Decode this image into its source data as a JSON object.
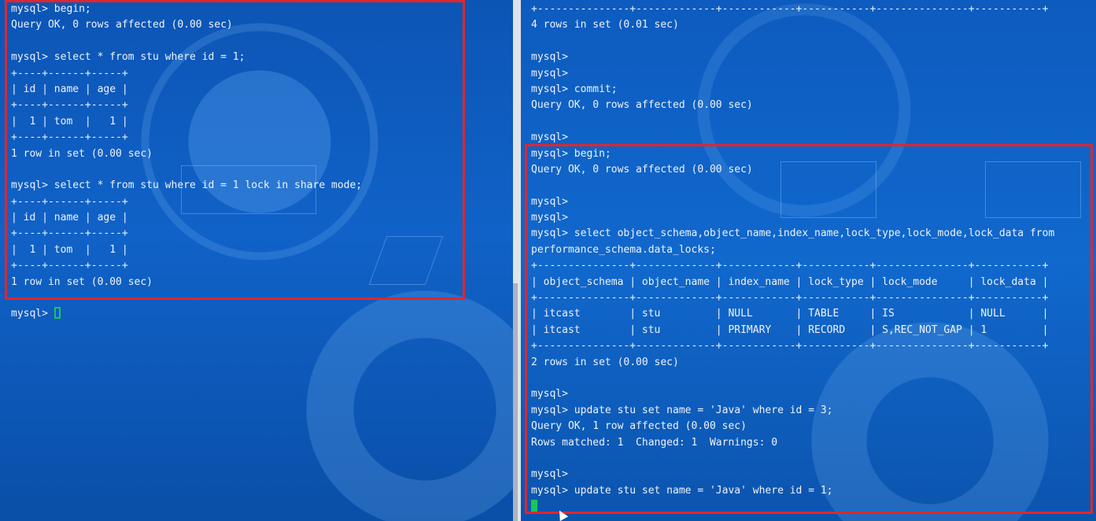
{
  "left_terminal": {
    "lines": [
      "mysql> begin;",
      "Query OK, 0 rows affected (0.00 sec)",
      "",
      "mysql> select * from stu where id = 1;",
      "+----+------+-----+",
      "| id | name | age |",
      "+----+------+-----+",
      "|  1 | tom  |   1 |",
      "+----+------+-----+",
      "1 row in set (0.00 sec)",
      "",
      "mysql> select * from stu where id = 1 lock in share mode;",
      "+----+------+-----+",
      "| id | name | age |",
      "+----+------+-----+",
      "|  1 | tom  |   1 |",
      "+----+------+-----+",
      "1 row in set (0.00 sec)",
      ""
    ],
    "prompt": "mysql> "
  },
  "right_terminal": {
    "lines": [
      "+---------------+-------------+------------+-----------+---------------+-----------+",
      "4 rows in set (0.01 sec)",
      "",
      "mysql>",
      "mysql>",
      "mysql> commit;",
      "Query OK, 0 rows affected (0.00 sec)",
      "",
      "mysql>",
      "mysql> begin;",
      "Query OK, 0 rows affected (0.00 sec)",
      "",
      "mysql>",
      "mysql>",
      "mysql> select object_schema,object_name,index_name,lock_type,lock_mode,lock_data from",
      "performance_schema.data_locks;",
      "+---------------+-------------+------------+-----------+---------------+-----------+",
      "| object_schema | object_name | index_name | lock_type | lock_mode     | lock_data |",
      "+---------------+-------------+------------+-----------+---------------+-----------+",
      "| itcast        | stu         | NULL       | TABLE     | IS            | NULL      |",
      "| itcast        | stu         | PRIMARY    | RECORD    | S,REC_NOT_GAP | 1         |",
      "+---------------+-------------+------------+-----------+---------------+-----------+",
      "2 rows in set (0.00 sec)",
      "",
      "mysql>",
      "mysql> update stu set name = 'Java' where id = 3;",
      "Query OK, 1 row affected (0.00 sec)",
      "Rows matched: 1  Changed: 1  Warnings: 0",
      "",
      "mysql>",
      "mysql> update stu set name = 'Java' where id = 1;"
    ]
  },
  "colors": {
    "terminal_text": "#eef3fa",
    "highlight_border": "#e0262b",
    "cursor": "#1ec45a",
    "background": "#0f4fa6"
  }
}
